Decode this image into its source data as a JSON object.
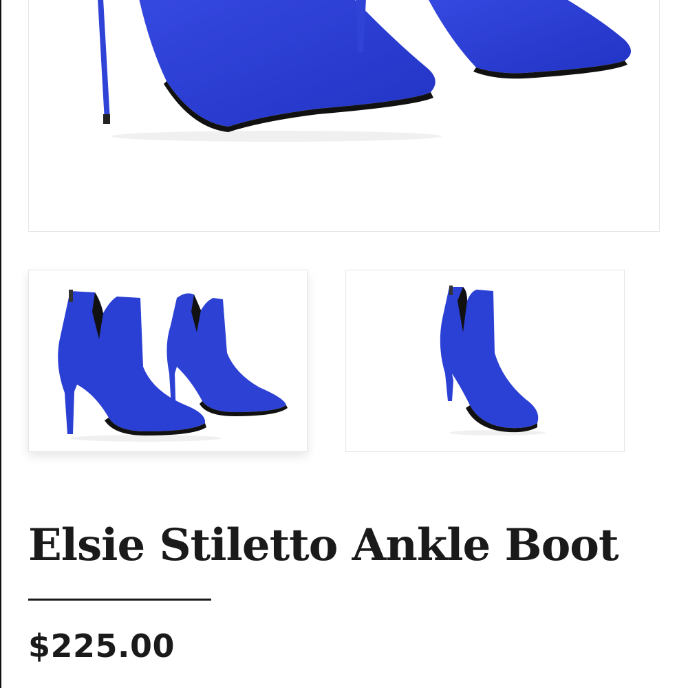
{
  "product": {
    "title": "Elsie Stiletto Ankle Boot",
    "price": "$225.00"
  },
  "gallery": {
    "main_image": {
      "alt": "Blue suede stiletto ankle boots, close-up"
    },
    "thumbnails": [
      {
        "alt": "Pair of blue suede stiletto ankle boots"
      },
      {
        "alt": "Single blue suede stiletto ankle boot"
      }
    ]
  },
  "colors": {
    "boot_blue": "#2b3fd1",
    "text": "#1a1a1a",
    "border": "#e6e6e6"
  }
}
